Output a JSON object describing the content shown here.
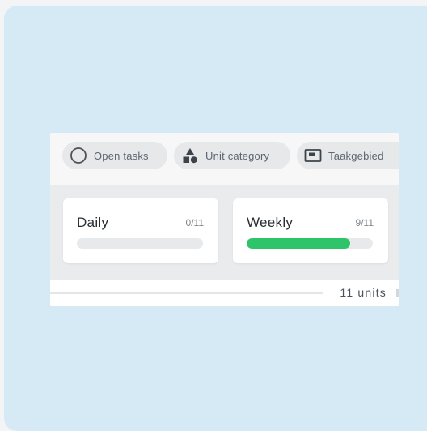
{
  "filters": {
    "open_tasks": {
      "label": "Open tasks",
      "icon": "circle-outline-icon"
    },
    "unit_category": {
      "label": "Unit category",
      "icon": "shapes-icon"
    },
    "task_area": {
      "label": "Taakgebied",
      "icon": "window-icon"
    }
  },
  "progress": {
    "daily": {
      "title": "Daily",
      "count": "0/11",
      "completed": 0,
      "total": 11
    },
    "weekly": {
      "title": "Weekly",
      "count": "9/11",
      "completed": 9,
      "total": 11
    }
  },
  "footer": {
    "units_label": "11 units"
  },
  "colors": {
    "background": "#d6eaf6",
    "progress_fill": "#2ec46a",
    "progress_track": "#e7e9eb"
  }
}
